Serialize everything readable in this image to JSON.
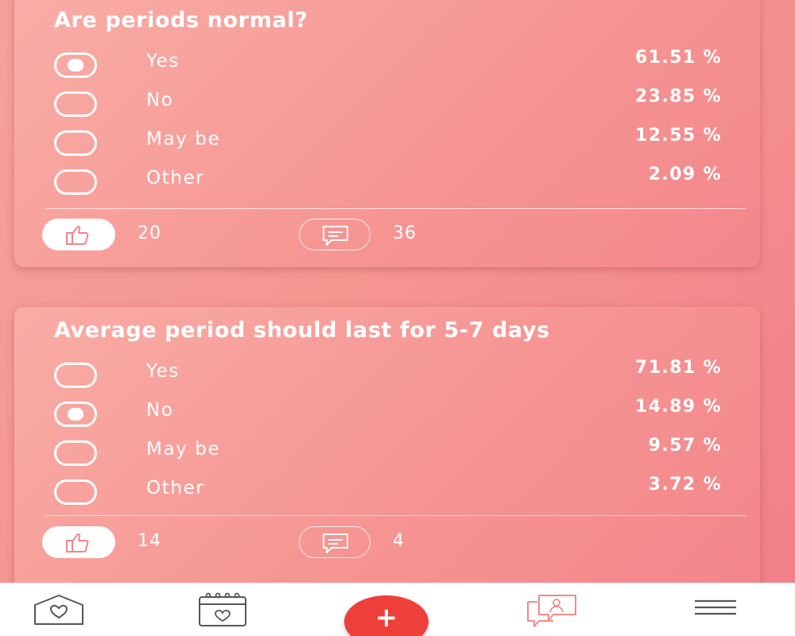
{
  "polls": [
    {
      "question": "Are periods normal?",
      "options": [
        {
          "label": "Yes",
          "percent": "61.51 %",
          "selected": true
        },
        {
          "label": "No",
          "percent": "23.85 %",
          "selected": false
        },
        {
          "label": "May be",
          "percent": "12.55 %",
          "selected": false
        },
        {
          "label": "Other",
          "percent": "2.09 %",
          "selected": false
        }
      ],
      "likes": "20",
      "comments": "36"
    },
    {
      "question": "Average period should last for 5-7 days",
      "options": [
        {
          "label": "Yes",
          "percent": "71.81 %",
          "selected": false
        },
        {
          "label": "No",
          "percent": "14.89 %",
          "selected": true
        },
        {
          "label": "May be",
          "percent": "9.57 %",
          "selected": false
        },
        {
          "label": "Other",
          "percent": "3.72 %",
          "selected": false
        }
      ],
      "likes": "14",
      "comments": "4"
    }
  ],
  "bottom_nav": {
    "items": [
      {
        "icon": "home-heart-icon",
        "active": false
      },
      {
        "icon": "calendar-heart-icon",
        "active": false
      },
      {
        "icon": "plus-icon",
        "label": "+",
        "active": false
      },
      {
        "icon": "chat-user-icon",
        "active": true
      },
      {
        "icon": "menu-icon",
        "active": false
      }
    ]
  },
  "colors": {
    "accent": "#ef3f3a",
    "background_start": "#f6a29c",
    "background_end": "#f27d8a",
    "icon_dark": "#555555",
    "icon_active": "#f08a8a"
  }
}
